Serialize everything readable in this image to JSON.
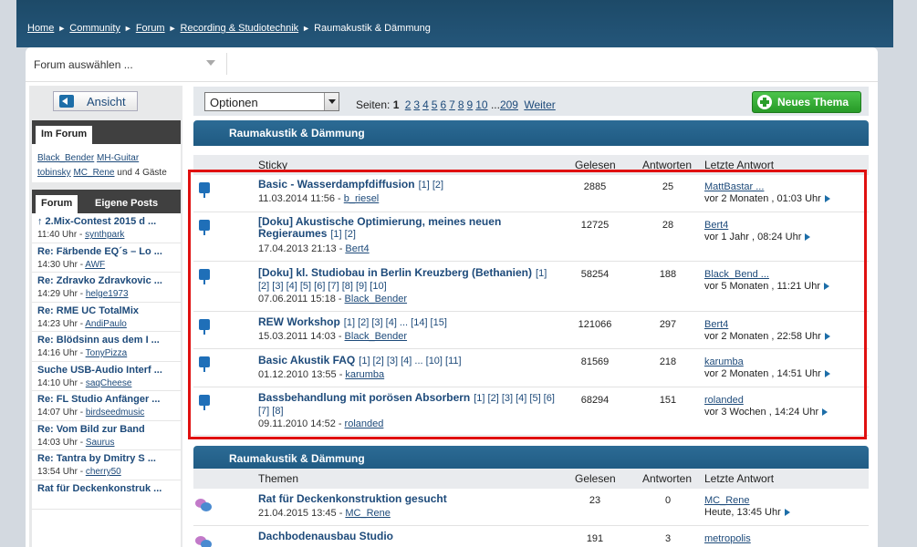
{
  "breadcrumb": {
    "items": [
      "Home",
      "Community",
      "Forum",
      "Recording & Studiotechnik"
    ],
    "current": "Raumakustik & Dämmung"
  },
  "forum_select": {
    "label": "Forum auswählen ..."
  },
  "sidebar": {
    "ansicht_label": "Ansicht",
    "imforum_tab": "Im Forum",
    "online_users": [
      "Black_Bender",
      "MH-Guitar",
      "tobinsky",
      "MC_Rene"
    ],
    "guests_text": "und 4 Gäste",
    "tab_forum": "Forum",
    "tab_eigene": "Eigene Posts",
    "posts": [
      {
        "title": "↑ 2.Mix-Contest 2015 d ...",
        "time": "11:40 Uhr",
        "user": "synthpark"
      },
      {
        "title": "Re: Färbende EQ´s – Lo ...",
        "time": "14:30 Uhr",
        "user": "AWF"
      },
      {
        "title": "Re: Zdravko Zdravkovic ...",
        "time": "14:29 Uhr",
        "user": "helge1973"
      },
      {
        "title": "Re: RME UC TotalMix",
        "time": "14:23 Uhr",
        "user": "AndiPaulo"
      },
      {
        "title": "Re: Blödsinn aus dem I ...",
        "time": "14:16 Uhr",
        "user": "TonyPizza"
      },
      {
        "title": "Suche USB-Audio Interf ...",
        "time": "14:10 Uhr",
        "user": "saqCheese"
      },
      {
        "title": "Re: FL Studio Anfänger ...",
        "time": "14:07 Uhr",
        "user": "birdseedmusic"
      },
      {
        "title": "Re: Vom Bild zur Band",
        "time": "14:03 Uhr",
        "user": "Saurus"
      },
      {
        "title": "Re: Tantra by Dmitry S ...",
        "time": "13:54 Uhr",
        "user": "cherry50"
      },
      {
        "title": "Rat für Deckenkonstruk ...",
        "time": "",
        "user": ""
      }
    ]
  },
  "toolbar": {
    "options_value": "Optionen",
    "pages_label": "Seiten:",
    "current_page": "1",
    "pages": [
      "2",
      "3",
      "4",
      "5",
      "6",
      "7",
      "8",
      "9",
      "10"
    ],
    "ellipsis": "...",
    "last_page": "209",
    "next_label": "Weiter",
    "new_thread_label": "Neues Thema"
  },
  "sticky_section": {
    "title": "Raumakustik & Dämmung",
    "col_topic": "Sticky",
    "col_read": "Gelesen",
    "col_answers": "Antworten",
    "col_last": "Letzte Antwort",
    "threads": [
      {
        "title": "Basic - Wasserdampfdiffusion",
        "pages": "[1] [2]",
        "date": "11.03.2014 11:56 -",
        "author": "b_riesel",
        "read": "2885",
        "answers": "25",
        "last_user": "MattBastar ...",
        "last_date": "vor 2 Monaten , 01:03 Uhr"
      },
      {
        "title": "[Doku] Akustische Optimierung, meines neuen Regieraumes",
        "pages": "[1] [2]",
        "date": "17.04.2013 21:13 -",
        "author": "Bert4",
        "read": "12725",
        "answers": "28",
        "last_user": "Bert4",
        "last_date": "vor 1 Jahr , 08:24 Uhr"
      },
      {
        "title": "[Doku] kl. Studiobau in Berlin Kreuzberg (Bethanien)",
        "pages": "[1] [2] [3] [4] [5] [6] [7] [8] [9] [10]",
        "date": "07.06.2011 15:18 -",
        "author": "Black_Bender",
        "read": "58254",
        "answers": "188",
        "last_user": "Black_Bend ...",
        "last_date": "vor 5 Monaten , 11:21 Uhr"
      },
      {
        "title": "REW Workshop",
        "pages": "[1] [2] [3] [4] ... [14] [15]",
        "date": "15.03.2011 14:03 -",
        "author": "Black_Bender",
        "read": "121066",
        "answers": "297",
        "last_user": "Bert4",
        "last_date": "vor 2 Monaten , 22:58 Uhr"
      },
      {
        "title": "Basic Akustik FAQ",
        "pages": "[1] [2] [3] [4] ... [10] [11]",
        "date": "01.12.2010 13:55 -",
        "author": "karumba",
        "read": "81569",
        "answers": "218",
        "last_user": "karumba",
        "last_date": "vor 2 Monaten , 14:51 Uhr"
      },
      {
        "title": "Bassbehandlung mit porösen Absorbern",
        "pages": "[1] [2] [3] [4] [5] [6] [7] [8]",
        "date": "09.11.2010 14:52 -",
        "author": "rolanded",
        "read": "68294",
        "answers": "151",
        "last_user": "rolanded",
        "last_date": "vor 3 Wochen , 14:24 Uhr"
      }
    ]
  },
  "topics_section": {
    "title": "Raumakustik & Dämmung",
    "col_topic": "Themen",
    "col_read": "Gelesen",
    "col_answers": "Antworten",
    "col_last": "Letzte Antwort",
    "threads": [
      {
        "title": "Rat für Deckenkonstruktion gesucht",
        "date": "21.04.2015 13:45 -",
        "author": "MC_Rene",
        "read": "23",
        "answers": "0",
        "last_user": "MC_Rene",
        "last_date": "Heute, 13:45 Uhr"
      },
      {
        "title": "Dachbodenausbau Studio",
        "date": "",
        "author": "",
        "read": "191",
        "answers": "3",
        "last_user": "metropolis",
        "last_date": ""
      }
    ]
  }
}
